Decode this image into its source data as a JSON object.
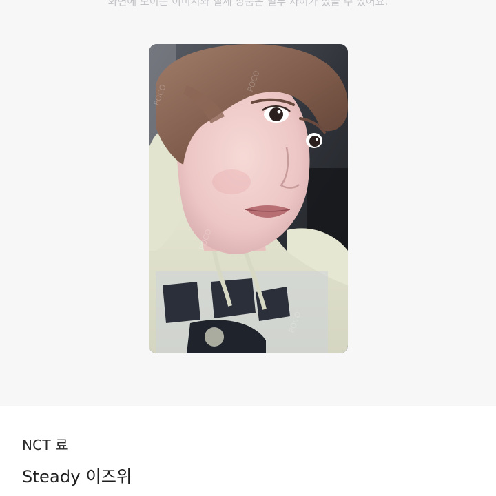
{
  "gallery": {
    "notice": "화면에 보이는 이미지와 실제 상품은 일부 차이가 있을 수 있어요.",
    "image_alt": "NCT 료 Steady 이즈위 포토카드"
  },
  "product": {
    "brand": "NCT 료",
    "title": "Steady 이즈위"
  }
}
